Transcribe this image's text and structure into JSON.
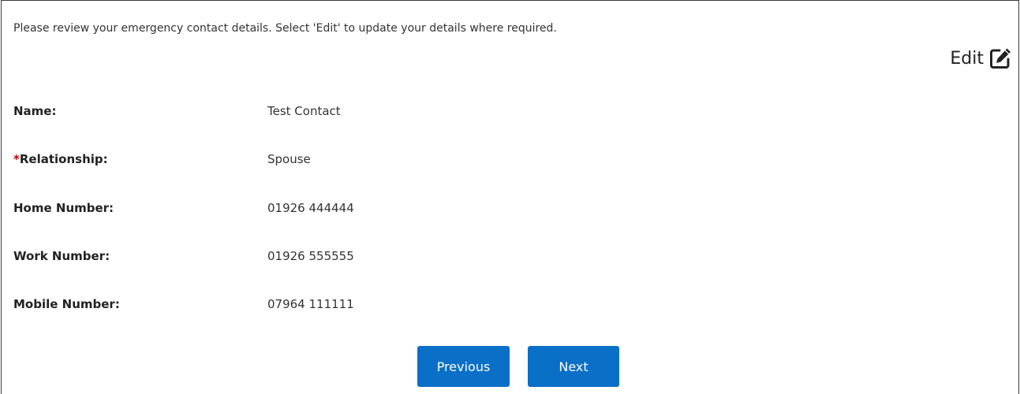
{
  "intro_text": "Please review your emergency contact details. Select 'Edit' to update your details where required.",
  "edit": {
    "label": "Edit",
    "icon": "edit-pencil-square-icon"
  },
  "fields": [
    {
      "label": "Name:",
      "value": "Test Contact",
      "required": false
    },
    {
      "label": "Relationship:",
      "value": "Spouse",
      "required": true,
      "required_marker": "*"
    },
    {
      "label": "Home Number:",
      "value": "01926 444444",
      "required": false
    },
    {
      "label": "Work Number:",
      "value": "01926 555555",
      "required": false
    },
    {
      "label": "Mobile Number:",
      "value": "07964 111111",
      "required": false
    }
  ],
  "buttons": {
    "previous_label": "Previous",
    "next_label": "Next"
  },
  "colors": {
    "button_bg": "#0a6fc7",
    "button_text": "#ffffff",
    "required_marker": "#c00000",
    "border": "#3a3a3a"
  }
}
